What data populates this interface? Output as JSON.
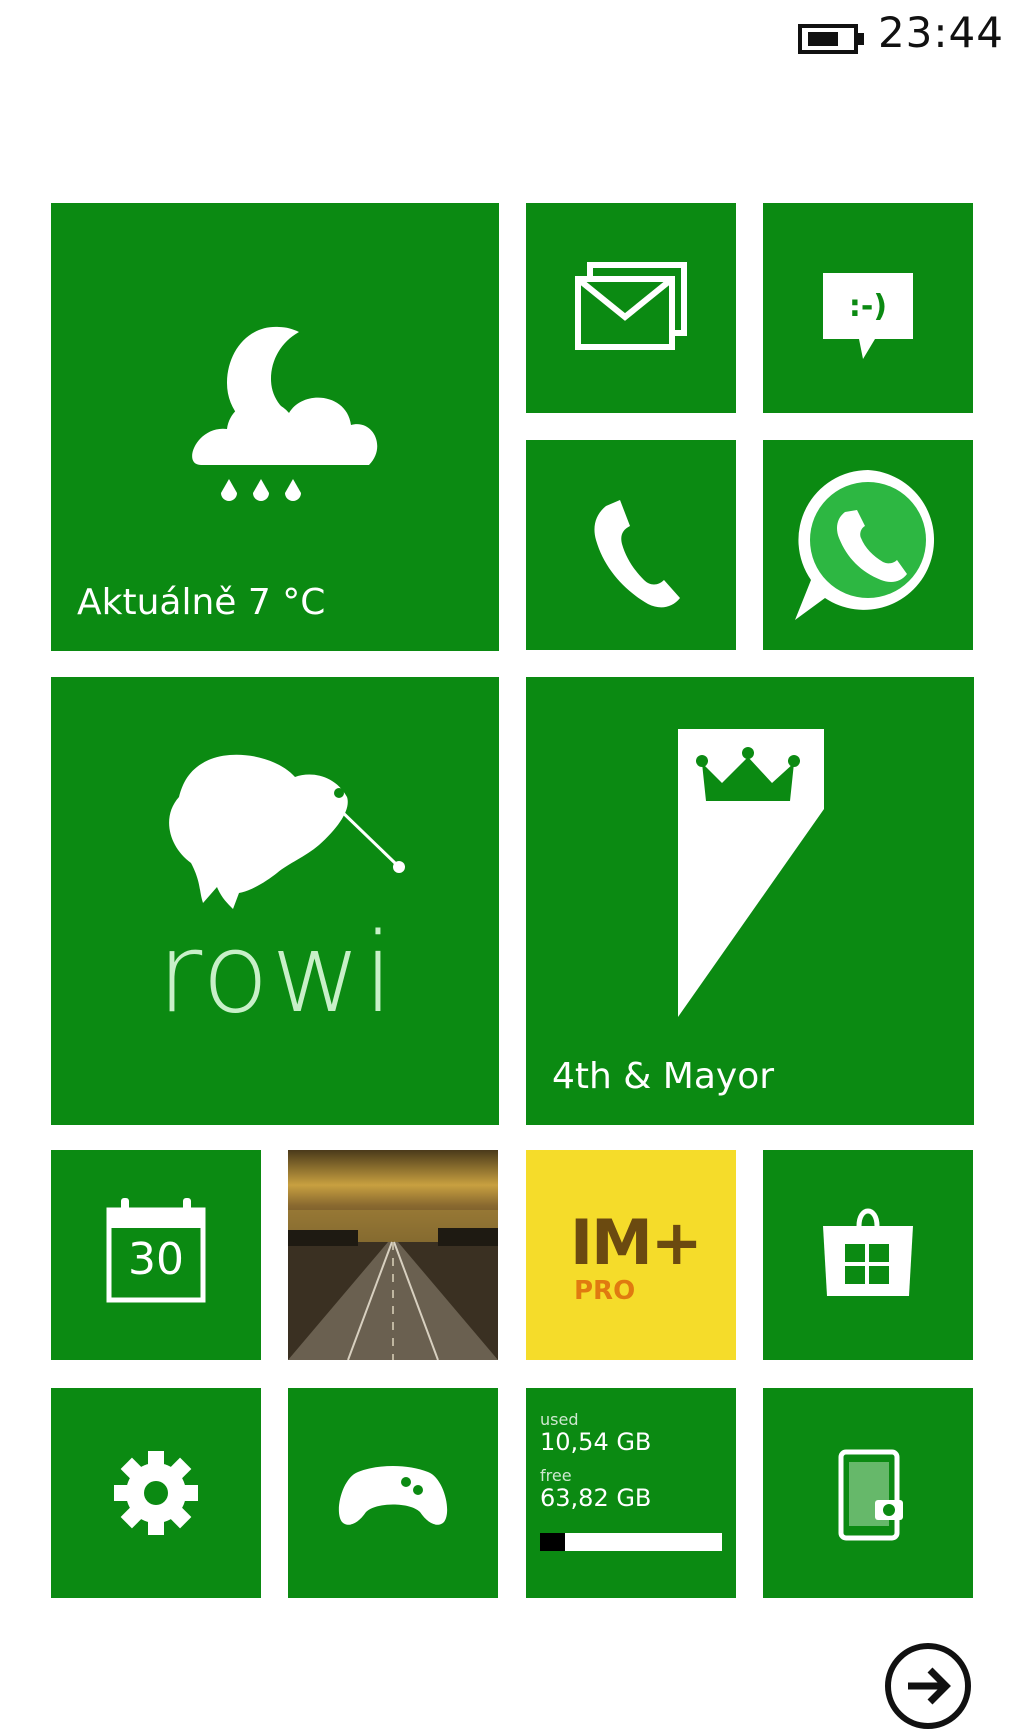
{
  "status_bar": {
    "time": "23:44",
    "icons": [
      "battery-icon"
    ]
  },
  "tiles": {
    "weather": {
      "label": "Aktuálně 7 °C",
      "icon": "moon-cloud-rain-icon"
    },
    "mail": {
      "icon": "mail-icon"
    },
    "messaging": {
      "icon": "message-smiley-icon",
      "glyph": ":-)"
    },
    "phone": {
      "icon": "phone-icon"
    },
    "whatsapp": {
      "icon": "whatsapp-icon"
    },
    "rowi": {
      "text": "rowi",
      "icon": "kiwi-bird-icon"
    },
    "mayor": {
      "label": "4th & Mayor",
      "icon": "crown-banner-icon"
    },
    "calendar": {
      "day": "30",
      "icon": "calendar-icon"
    },
    "photo": {
      "icon": "road-photo"
    },
    "im_plus": {
      "main": "IM+",
      "sub": "PRO"
    },
    "store": {
      "icon": "store-icon"
    },
    "settings": {
      "icon": "gear-icon"
    },
    "games": {
      "icon": "gamepad-icon"
    },
    "storage": {
      "used_label": "used",
      "used_value": "10,54 GB",
      "free_label": "free",
      "free_value": "63,82 GB",
      "used_fraction": 0.14
    },
    "phone_backup": {
      "icon": "phone-camera-icon"
    }
  },
  "navigation": {
    "next_icon": "arrow-right-icon"
  },
  "colors": {
    "accent": "#0b8a12",
    "yellow_tile": "#f5dc2a",
    "background": "#ffffff"
  }
}
